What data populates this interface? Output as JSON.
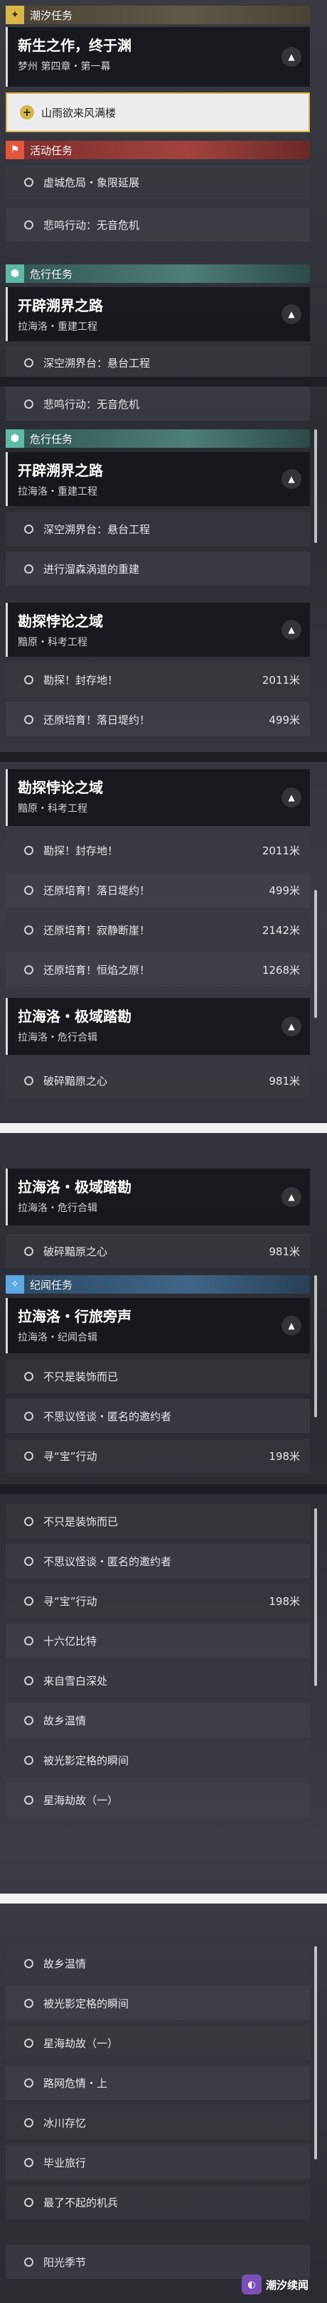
{
  "sections": {
    "chaoxi": "潮汐任务",
    "activity": "活动任务",
    "danger": "危行任务",
    "jiwen": "纪闻任务"
  },
  "icons": {
    "chaoxi": "sparkle-icon",
    "activity": "flag-icon",
    "danger": "hex-icon",
    "jiwen": "compass-icon"
  },
  "main_quest": {
    "title": "新生之作，终于渊",
    "subtitle": "梦州 第四章・第一幕"
  },
  "action": {
    "label": "山雨欲来风满楼"
  },
  "activity_items": [
    "虚城危局・象限延展",
    "悲鸣行动：无音危机"
  ],
  "quests": {
    "kaipi": {
      "title": "开辟溯界之路",
      "subtitle": "拉海洛・重建工程"
    },
    "kaipi_items": [
      "深空溯界台：悬台工程",
      "进行溜森涡道的重建"
    ],
    "kantan": {
      "title": "勘探悖论之域",
      "subtitle": "黯原・科考工程"
    },
    "kantan_items": [
      {
        "label": "勘探！封存地！",
        "dist": "2011米"
      },
      {
        "label": "还原培育！落日堤约！",
        "dist": "499米"
      },
      {
        "label": "还原培育！寂静断崖！",
        "dist": "2142米"
      },
      {
        "label": "还原培育！恒焰之原！",
        "dist": "1268米"
      }
    ],
    "jiyu": {
      "title": "拉海洛・极域踏勘",
      "subtitle": "拉海洛・危行合辑"
    },
    "jiyu_items": [
      {
        "label": "破碎黯原之心",
        "dist": "981米"
      }
    ],
    "lvxing": {
      "title": "拉海洛・行旅旁声",
      "subtitle": "拉海洛・纪闻合辑"
    },
    "lvxing_items": [
      {
        "label": "不只是装饰而已",
        "dist": ""
      },
      {
        "label": "不思议怪谈・匿名的邀约者",
        "dist": ""
      },
      {
        "label": "寻“宝”行动",
        "dist": "198米"
      },
      {
        "label": "十六亿比特",
        "dist": ""
      },
      {
        "label": "来自雪白深处",
        "dist": ""
      },
      {
        "label": "故乡温情",
        "dist": ""
      },
      {
        "label": "被光影定格的瞬间",
        "dist": ""
      },
      {
        "label": "星海劫故（一）",
        "dist": ""
      },
      {
        "label": "路网危情・上",
        "dist": ""
      },
      {
        "label": "冰川存忆",
        "dist": ""
      },
      {
        "label": "毕业旅行",
        "dist": ""
      },
      {
        "label": "最了不起的机兵",
        "dist": ""
      },
      {
        "label": "阳光季节",
        "dist": ""
      }
    ]
  },
  "watermark": "潮汐续闻",
  "watermark_icon": "app-logo-icon"
}
